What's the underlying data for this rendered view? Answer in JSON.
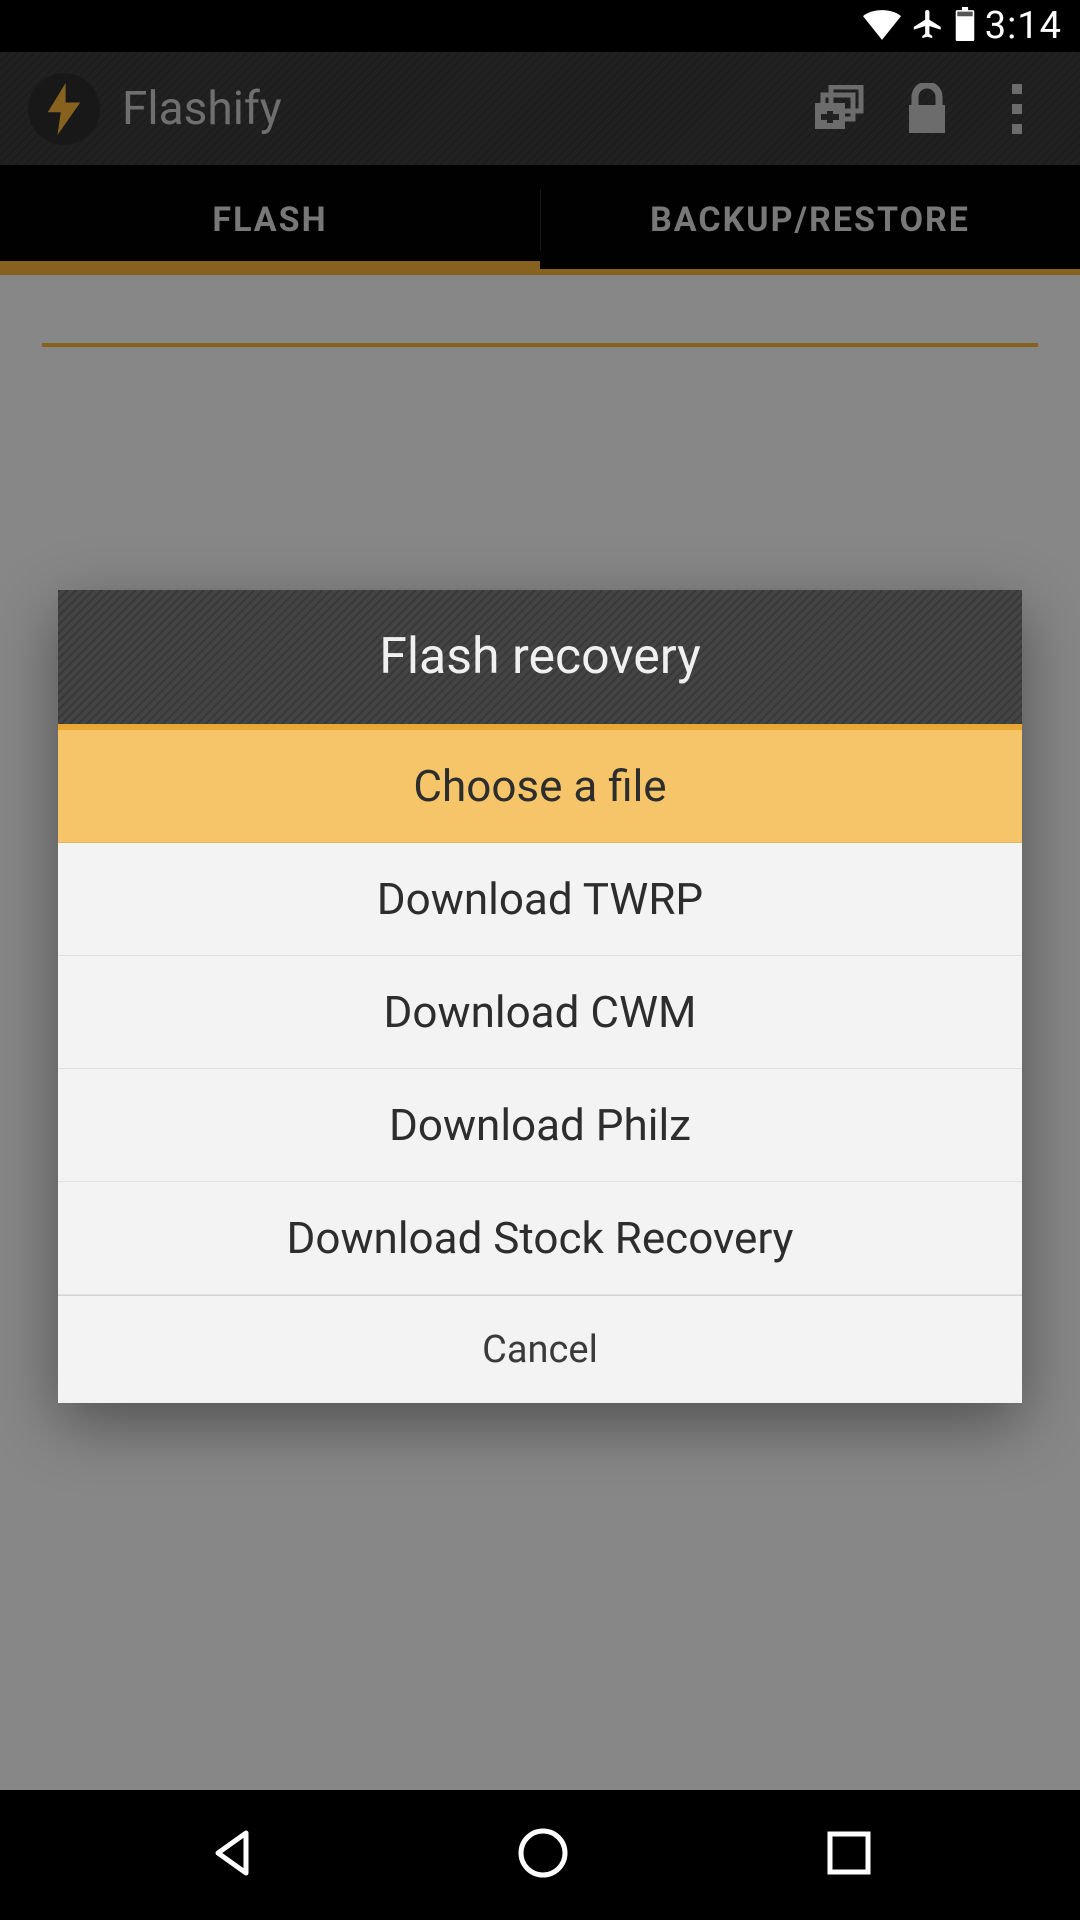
{
  "status_bar": {
    "time": "3:14"
  },
  "header": {
    "app_title": "Flashify",
    "icons": {
      "app": "lightning-bolt-icon",
      "add": "add-tab-icon",
      "lock": "lock-icon",
      "overflow": "overflow-menu-icon"
    }
  },
  "tabs": {
    "active": "FLASH",
    "items": [
      {
        "label": "FLASH"
      },
      {
        "label": "BACKUP/RESTORE"
      }
    ]
  },
  "dialog": {
    "title": "Flash recovery",
    "options": [
      {
        "label": "Choose a file",
        "highlighted": true
      },
      {
        "label": "Download TWRP",
        "highlighted": false
      },
      {
        "label": "Download CWM",
        "highlighted": false
      },
      {
        "label": "Download Philz",
        "highlighted": false
      },
      {
        "label": "Download Stock Recovery",
        "highlighted": false
      }
    ],
    "cancel_label": "Cancel"
  },
  "colors": {
    "accent": "#e9a834",
    "highlight": "#f6c569"
  }
}
